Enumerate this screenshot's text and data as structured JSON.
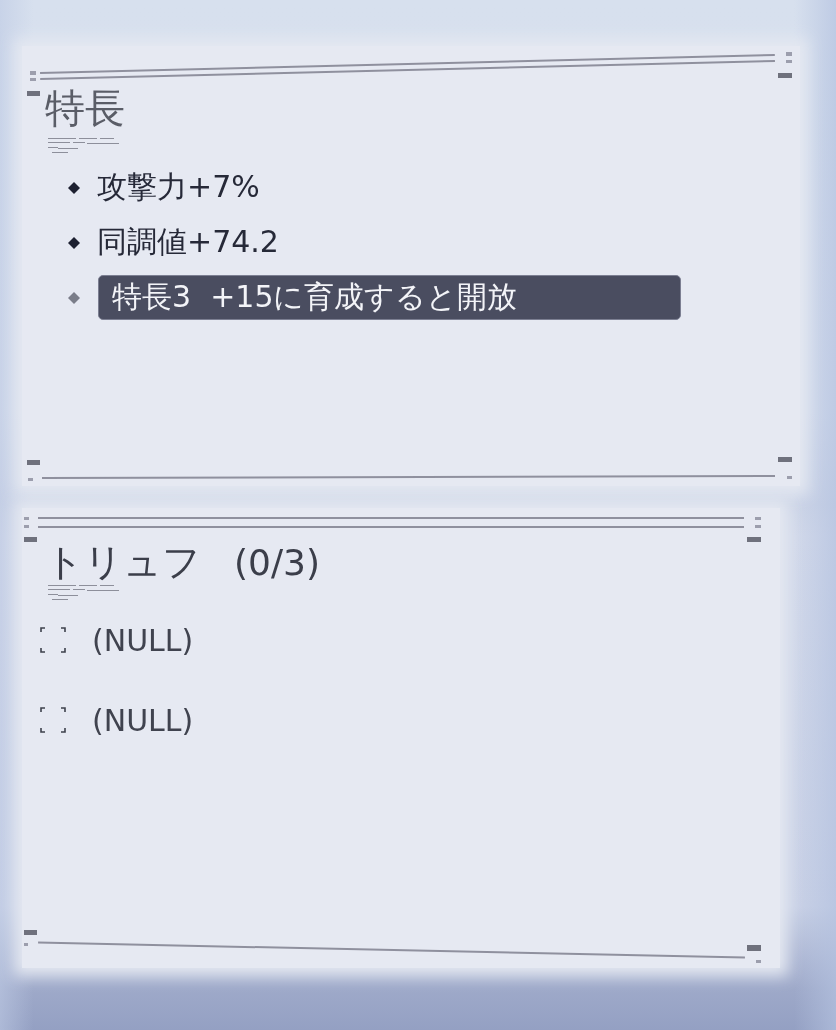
{
  "traits": {
    "title": "特長",
    "items": [
      {
        "text": "攻撃力+7%",
        "locked": false
      },
      {
        "text": "同調値+74.2",
        "locked": false
      },
      {
        "text": "特長3  +15に育成すると開放",
        "locked": true
      }
    ]
  },
  "truffles": {
    "title": "トリュフ",
    "count": "(0/3)",
    "slots": [
      {
        "text": "(NULL)"
      },
      {
        "text": "(NULL)"
      }
    ]
  }
}
